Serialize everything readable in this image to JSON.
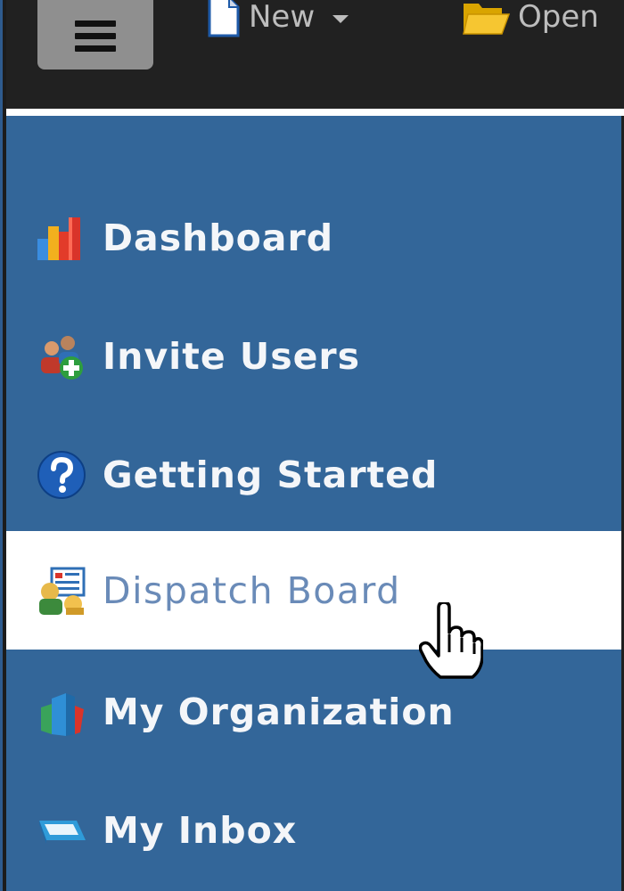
{
  "toolbar": {
    "menu_button": "hamburger-menu",
    "items": [
      {
        "label": "New",
        "icon": "document-icon"
      },
      {
        "label": "Open",
        "icon": "folder-icon"
      }
    ]
  },
  "sidebar": {
    "items": [
      {
        "label": "Dashboard",
        "icon": "bar-chart-icon"
      },
      {
        "label": "Invite Users",
        "icon": "add-users-icon"
      },
      {
        "label": "Getting Started",
        "icon": "help-icon"
      },
      {
        "label": "Dispatch Board",
        "icon": "dispatch-board-icon",
        "state": "hovered"
      },
      {
        "label": "My Organization",
        "icon": "organization-icon"
      },
      {
        "label": "My Inbox",
        "icon": "inbox-icon"
      }
    ]
  },
  "colors": {
    "sidebar_bg": "#336699",
    "active_bg": "#ffffff",
    "active_text": "#6a8bb8",
    "toolbar_bg": "#212121"
  }
}
